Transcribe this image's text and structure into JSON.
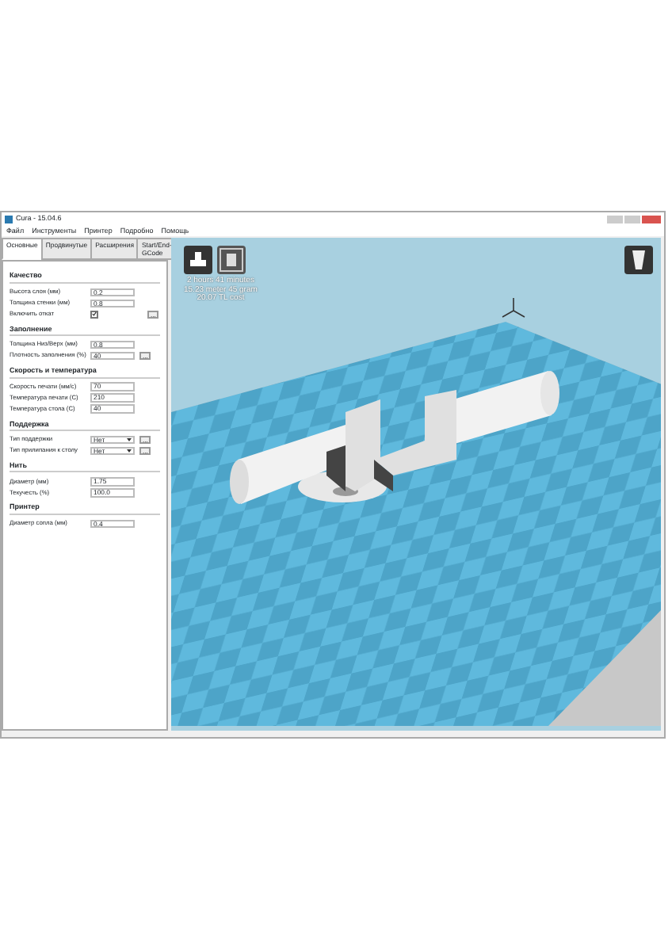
{
  "window": {
    "title": "Cura - 15.04.6"
  },
  "menu": [
    "Файл",
    "Инструменты",
    "Принтер",
    "Подробно",
    "Помощь"
  ],
  "tabs": [
    {
      "label": "Основные",
      "selected": true
    },
    {
      "label": "Продвинутые",
      "selected": false
    },
    {
      "label": "Расширения",
      "selected": false
    },
    {
      "label": "Start/End-GCode",
      "selected": false
    }
  ],
  "sections": [
    {
      "title": "Качество",
      "items": [
        {
          "kind": "field",
          "label": "Высота слоя (мм)",
          "value": "0.2"
        },
        {
          "kind": "field",
          "label": "Толщина стенки (мм)",
          "value": "0.8"
        },
        {
          "kind": "checkbox",
          "label": "Включить откат",
          "checked": true,
          "more": "..."
        }
      ]
    },
    {
      "title": "Заполнение",
      "items": [
        {
          "kind": "field",
          "label": "Толщина Низ/Верх (мм)",
          "value": "0.8"
        },
        {
          "kind": "field",
          "label": "Плотность заполнения (%)",
          "value": "40",
          "more": "..."
        }
      ]
    },
    {
      "title": "Скорость и температура",
      "items": [
        {
          "kind": "field",
          "label": "Скорость печати (мм/с)",
          "value": "70"
        },
        {
          "kind": "field",
          "label": "Температура печати (C)",
          "value": "210"
        },
        {
          "kind": "field",
          "label": "Температура стола (C)",
          "value": "40"
        }
      ]
    },
    {
      "title": "Поддержка",
      "items": [
        {
          "kind": "select",
          "label": "Тип поддержки",
          "value": "Нет",
          "more": "..."
        },
        {
          "kind": "select",
          "label": "Тип прилипания к столу",
          "value": "Нет",
          "more": "..."
        }
      ]
    },
    {
      "title": "Нить",
      "items": [
        {
          "kind": "field",
          "label": "Диаметр (мм)",
          "value": "1.75"
        },
        {
          "kind": "field",
          "label": "Текучесть (%)",
          "value": "100.0"
        }
      ]
    },
    {
      "title": "Принтер",
      "items": [
        {
          "kind": "field",
          "label": "Диаметр сопла (мм)",
          "value": "0.4"
        }
      ]
    }
  ],
  "viewport": {
    "print_info": [
      "2 hours 41 minutes",
      "15.23 meter 45 gram",
      "20.07 TL cost"
    ]
  }
}
